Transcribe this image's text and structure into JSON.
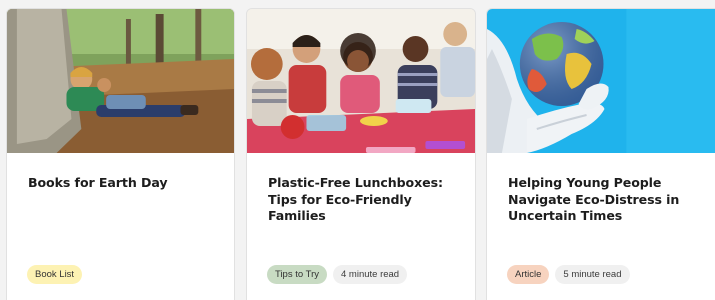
{
  "cards": [
    {
      "title": "Books for Earth Day",
      "tag": "Book List",
      "tag_color": "#fdf2b3",
      "image": "child-reading-under-tree"
    },
    {
      "title": "Plastic-Free Lunchboxes: Tips for Eco-Friendly Families",
      "tag": "Tips to Try",
      "tag_color": "#c8dbc3",
      "read_time": "4 minute read",
      "image": "children-lunch-table"
    },
    {
      "title": "Helping Young People Navigate Eco-Distress in Uncertain Times",
      "tag": "Article",
      "tag_color": "#f7d3bf",
      "read_time": "5 minute read",
      "image": "gloved-hands-holding-globe"
    }
  ]
}
